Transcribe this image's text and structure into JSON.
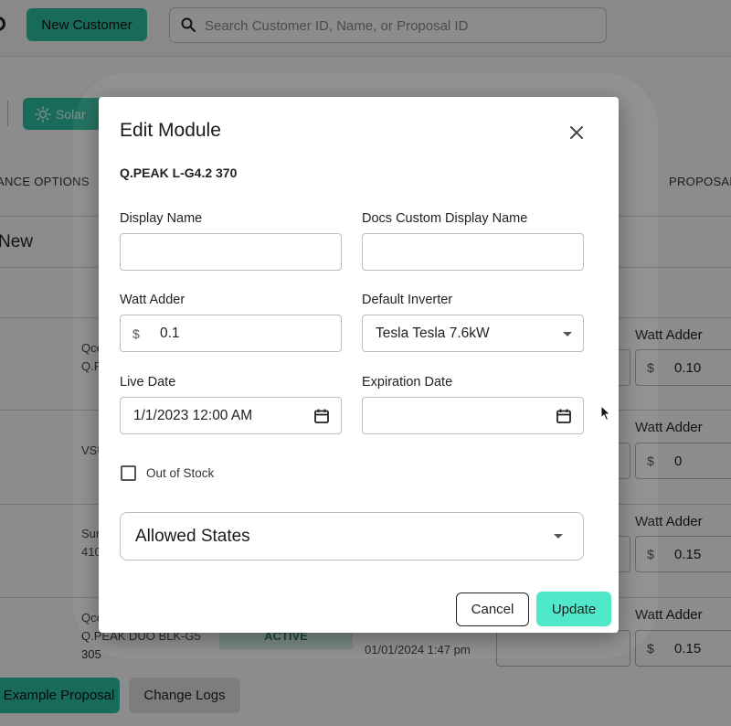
{
  "background": {
    "new_customer_label": "New Customer",
    "search_placeholder": "Search Customer ID, Name, or Proposal ID",
    "solar_label": "Solar",
    "tab_left": "ANCE OPTIONS",
    "tab_right": "PROPOSAL",
    "section_title": "New",
    "rows": [
      {
        "line1": "Qce",
        "line2": "Q.P",
        "watt_adder_label": "Watt Adder",
        "watt_adder_value": "0.10"
      },
      {
        "line1": "VSU",
        "line2": "",
        "watt_adder_label": "Watt Adder",
        "watt_adder_value": "0"
      },
      {
        "line1": "Sur",
        "line2": "410",
        "watt_adder_label": "Watt Adder",
        "watt_adder_value": "0.15"
      },
      {
        "line1": "Qce",
        "line2": "Q.PEAK DUO BLK-G5",
        "line3": "305",
        "watt_adder_label": "Watt Adder",
        "watt_adder_value": "0.15",
        "status": "ACTIVE",
        "date": "01/01/2024 1:47 pm"
      }
    ],
    "currency_symbol": "$",
    "example_proposal_label": "Example Proposal",
    "change_logs_label": "Change Logs"
  },
  "modal": {
    "title": "Edit Module",
    "module_name": "Q.PEAK L-G4.2 370",
    "display_name": {
      "label": "Display Name",
      "value": ""
    },
    "docs_display_name": {
      "label": "Docs Custom Display Name",
      "value": ""
    },
    "watt_adder": {
      "label": "Watt Adder",
      "currency": "$",
      "value": "0.1"
    },
    "default_inverter": {
      "label": "Default Inverter",
      "value": "Tesla Tesla 7.6kW"
    },
    "live_date": {
      "label": "Live Date",
      "value": "1/1/2023 12:00 AM"
    },
    "expiration_date": {
      "label": "Expiration Date",
      "value": ""
    },
    "out_of_stock": {
      "label": "Out of Stock",
      "checked": false
    },
    "allowed_states_label": "Allowed States",
    "cancel_label": "Cancel",
    "update_label": "Update"
  },
  "colors": {
    "accent": "#2cc3a4",
    "update_button": "#4fe8c8"
  }
}
